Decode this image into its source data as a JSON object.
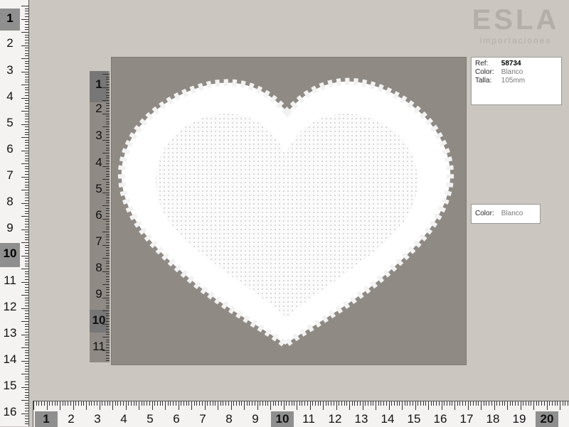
{
  "logo": {
    "brand": "ESLA",
    "tagline": "importaciones"
  },
  "left_ruler": {
    "labels": [
      "1",
      "2",
      "3",
      "4",
      "5",
      "6",
      "7",
      "8",
      "9",
      "10",
      "11",
      "12",
      "13",
      "14",
      "15",
      "16"
    ],
    "highlighted": [
      "1",
      "10"
    ]
  },
  "bottom_ruler": {
    "labels": [
      "1",
      "2",
      "3",
      "4",
      "5",
      "6",
      "7",
      "8",
      "9",
      "10",
      "11",
      "12",
      "13",
      "14",
      "15",
      "16",
      "17",
      "18",
      "19",
      "20"
    ],
    "highlighted": [
      "1",
      "10",
      "20"
    ]
  },
  "inner_ruler": {
    "labels": [
      "1",
      "2",
      "3",
      "4",
      "5",
      "6",
      "7",
      "8",
      "9",
      "10",
      "11"
    ],
    "highlighted": [
      "1",
      "10"
    ]
  },
  "info_main": {
    "ref_label": "Ref:",
    "ref_value": "58734",
    "color_label": "Color:",
    "color_value": "Blanco",
    "size_label": "Talla:",
    "size_value": "105mm"
  },
  "info_color": {
    "color_label": "Color:",
    "color_value": "Blanco"
  },
  "colors": {
    "background": "#cbc6bf",
    "photo": "#8f8a84",
    "lace": "#ffffff"
  }
}
